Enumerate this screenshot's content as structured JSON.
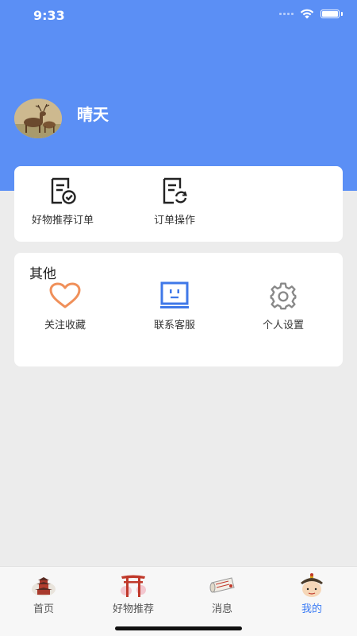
{
  "status_bar": {
    "time": "9:33"
  },
  "profile": {
    "name": "晴天",
    "avatar": "deer-avatar"
  },
  "orders": {
    "items": [
      {
        "label": "好物推荐订单",
        "icon": "document-check-icon"
      },
      {
        "label": "订单操作",
        "icon": "document-refresh-icon"
      }
    ]
  },
  "other": {
    "title": "其他",
    "items": [
      {
        "label": "关注收藏",
        "icon": "heart-icon",
        "color": "#f0905a"
      },
      {
        "label": "联系客服",
        "icon": "robot-face-icon",
        "color": "#3f78e8"
      },
      {
        "label": "个人设置",
        "icon": "gear-icon",
        "color": "#888888"
      }
    ]
  },
  "tabbar": {
    "items": [
      {
        "label": "首页",
        "icon": "pagoda-icon",
        "active": false
      },
      {
        "label": "好物推荐",
        "icon": "torii-gate-icon",
        "active": false
      },
      {
        "label": "消息",
        "icon": "scroll-icon",
        "active": false
      },
      {
        "label": "我的",
        "icon": "emperor-avatar-icon",
        "active": true
      }
    ],
    "active_color": "#3a7bf5"
  },
  "colors": {
    "header": "#5b8ff5",
    "background": "#ececec"
  }
}
